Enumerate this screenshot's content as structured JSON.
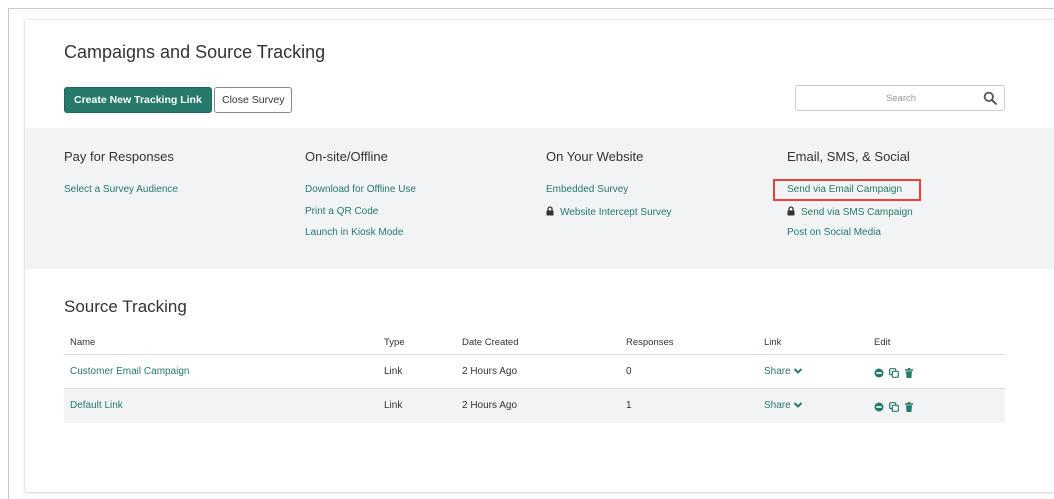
{
  "header": {
    "title": "Campaigns and Source Tracking",
    "create_button": "Create New Tracking Link",
    "close_button": "Close Survey",
    "search_placeholder": "Search"
  },
  "distribution": {
    "columns": [
      {
        "title": "Pay for Responses",
        "links": [
          {
            "label": "Select a Survey Audience",
            "locked": false
          }
        ]
      },
      {
        "title": "On-site/Offline",
        "links": [
          {
            "label": "Download for Offline Use",
            "locked": false
          },
          {
            "label": "Print a QR Code",
            "locked": false
          },
          {
            "label": "Launch in Kiosk Mode",
            "locked": false
          }
        ]
      },
      {
        "title": "On Your Website",
        "links": [
          {
            "label": "Embedded Survey",
            "locked": false
          },
          {
            "label": "Website Intercept Survey",
            "locked": true
          }
        ]
      },
      {
        "title": "Email, SMS, & Social",
        "links": [
          {
            "label": "Send via Email Campaign",
            "locked": false,
            "highlighted": true
          },
          {
            "label": "Send via SMS Campaign",
            "locked": true
          },
          {
            "label": "Post on Social Media",
            "locked": false
          }
        ]
      }
    ]
  },
  "source_tracking": {
    "title": "Source Tracking",
    "headers": {
      "name": "Name",
      "type": "Type",
      "date": "Date Created",
      "responses": "Responses",
      "link": "Link",
      "edit": "Edit"
    },
    "rows": [
      {
        "name": "Customer Email Campaign",
        "type": "Link",
        "date": "2 Hours Ago",
        "responses": "0",
        "link": "Share"
      },
      {
        "name": "Default Link",
        "type": "Link",
        "date": "2 Hours Ago",
        "responses": "1",
        "link": "Share"
      }
    ]
  },
  "colors": {
    "accent": "#267a6b",
    "highlight": "#e8403a",
    "panel": "#f1f3f5"
  }
}
